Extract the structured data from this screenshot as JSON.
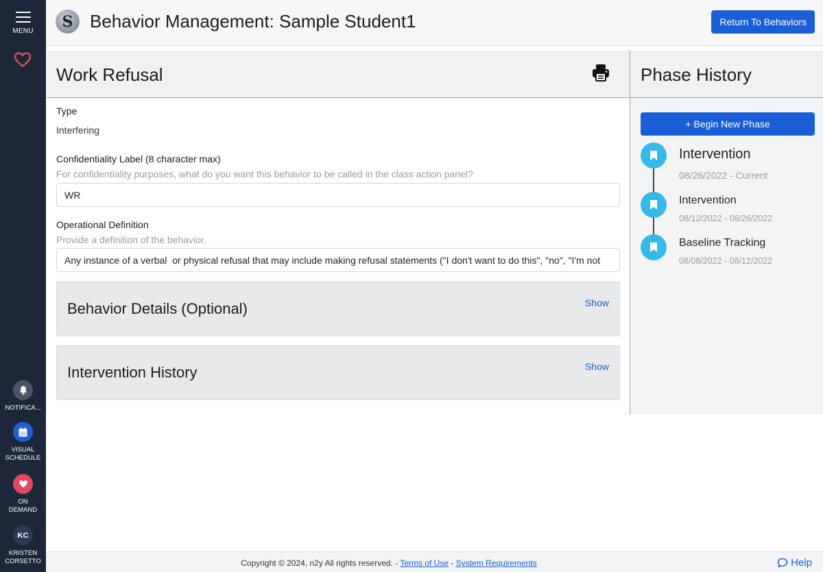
{
  "sidebar": {
    "menu_label": "MENU",
    "favorites_icon": "heart-outline-icon",
    "items": [
      {
        "label": "NOTIFICA...",
        "icon": "bell-icon"
      },
      {
        "label": "VISUAL SCHEDULE",
        "icon": "calendar-icon"
      },
      {
        "label": "ON DEMAND",
        "icon": "heart-icon"
      },
      {
        "label": "KRISTEN CORSETTO",
        "initials": "KC"
      }
    ]
  },
  "header": {
    "logo_letter": "S",
    "title": "Behavior Management: Sample Student1",
    "return_button": "Return To Behaviors"
  },
  "behavior": {
    "title": "Work Refusal",
    "type_label": "Type",
    "type_value": "Interfering",
    "conf_label": "Confidentiality Label (8 character max)",
    "conf_help": "For confidentiality purposes, what do you want this behavior to be called in the class action panel?",
    "conf_value": "WR",
    "def_label": "Operational Definition",
    "def_help": "Provide a definition of the behavior.",
    "def_value": "Any instance of a verbal  or physical refusal that may include making refusal statements (\"I don't want to do this\", \"no\", \"I'm not",
    "details_title": "Behavior Details (Optional)",
    "history_title": "Intervention History",
    "show_label": "Show"
  },
  "phase": {
    "title": "Phase History",
    "new_button": "+ Begin New Phase",
    "items": [
      {
        "name": "Intervention",
        "dates": "08/26/2022 - Current"
      },
      {
        "name": "Intervention",
        "dates": "08/12/2022 - 08/26/2022"
      },
      {
        "name": "Baseline Tracking",
        "dates": "08/08/2022 - 08/12/2022"
      }
    ]
  },
  "footer": {
    "copyright": "Copyright © 2024, n2y All rights reserved. - ",
    "terms": "Terms of Use",
    "sep": " - ",
    "sysreq": "System Requirements",
    "help": "Help"
  },
  "colors": {
    "sidebar": "#1c2839",
    "primary": "#1a5fd8",
    "timeline_dot": "#36b8e8",
    "heart": "#e64664"
  }
}
